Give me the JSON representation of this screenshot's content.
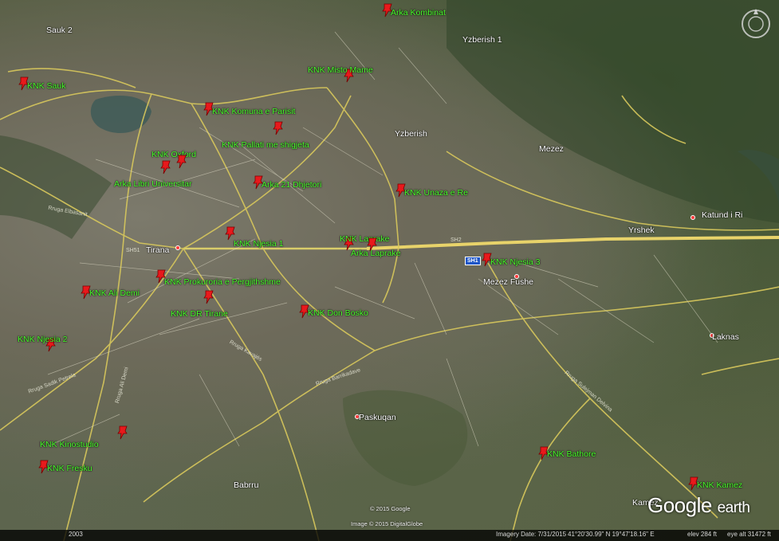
{
  "map": {
    "brand": {
      "google": "Google",
      "earth": "earth"
    },
    "copyright_google": "© 2015 Google",
    "copyright_image": "Image © 2015 DigitalGlobe",
    "status": {
      "imagery_date": "Imagery Date: 7/31/2015",
      "coords": "41°20'30.99\" N  19°47'18.16\" E",
      "elev": "elev  284 ft",
      "eye_alt": "eye alt  31472 ft",
      "year_badge": "2003"
    },
    "highway_shield": "SH1",
    "markers": [
      {
        "name": "marker-arka-kombinat",
        "label": "Arka Kombinat"
      },
      {
        "name": "marker-knk-sauk",
        "label": "KNK Sauk"
      },
      {
        "name": "marker-knk-misto-mame",
        "label": "KNK Misto Mame"
      },
      {
        "name": "marker-knk-komuna-e-parisit",
        "label": "KNK Komuna e Parisit"
      },
      {
        "name": "marker-knk-pallati-me-shigjeta",
        "label": "KNK Pallati me shigjeta"
      },
      {
        "name": "marker-knk-oxford",
        "label": "KNK Oxford"
      },
      {
        "name": "marker-arka-libri-universitar",
        "label": "Arka Libri Universitar"
      },
      {
        "name": "marker-arka-21-dhjetori",
        "label": "Arka 21 Dhjetori"
      },
      {
        "name": "marker-knk-unaza-e-re",
        "label": "KNK Unaza e Re"
      },
      {
        "name": "marker-knk-lapraka",
        "label": "KNK Laprake"
      },
      {
        "name": "marker-arka-lapraka",
        "label": "Arka Laprake"
      },
      {
        "name": "marker-knk-njesia-1",
        "label": "KNK Njesia 1"
      },
      {
        "name": "marker-knk-njesia-3",
        "label": "KNK Njesia 3"
      },
      {
        "name": "marker-knk-prokuroria",
        "label": "KNK Prokuroria e Pergjithshme"
      },
      {
        "name": "marker-knk-ali-demi",
        "label": "KNK Ali Demi"
      },
      {
        "name": "marker-knk-dr-tirane",
        "label": "KNK DR Tirane"
      },
      {
        "name": "marker-knk-don-bosko",
        "label": "KNK Don Bosko"
      },
      {
        "name": "marker-knk-njesia-2",
        "label": "KNK Njesia 2"
      },
      {
        "name": "marker-knk-kinostudio",
        "label": "KNK Kinostudio"
      },
      {
        "name": "marker-knk-fresku",
        "label": "KNK Fresku"
      },
      {
        "name": "marker-knk-bathore",
        "label": "KNK Bathore"
      },
      {
        "name": "marker-knk-kamez",
        "label": "KNK Kamez"
      }
    ],
    "places": [
      {
        "name": "place-sauk-2",
        "label": "Sauk 2"
      },
      {
        "name": "place-yzberish-1",
        "label": "Yzberish 1"
      },
      {
        "name": "place-yzberish",
        "label": "Yzberish"
      },
      {
        "name": "place-mezez",
        "label": "Mezez"
      },
      {
        "name": "place-katund-i-ri",
        "label": "Katund i Ri"
      },
      {
        "name": "place-yrshek",
        "label": "Yrshek"
      },
      {
        "name": "place-tirana",
        "label": "Tirana"
      },
      {
        "name": "place-mezez-fushe",
        "label": "Mezez Fushe"
      },
      {
        "name": "place-laknas",
        "label": "Laknas"
      },
      {
        "name": "place-paskuqan",
        "label": "Paskuqan"
      },
      {
        "name": "place-babrru",
        "label": "Babrru"
      },
      {
        "name": "place-kamez",
        "label": "Kamez"
      }
    ],
    "road_labels": [
      "Rruga Elbasanit",
      "Rruga Sadik Petrela",
      "Rruga e Dibrës",
      "Rruga Ali Demi",
      "Rruga Kavajës",
      "Rruga Durrës",
      "SH2",
      "Rruga Barrikadave",
      "Rruga Sulejman Delvina",
      "Rruga Dritan Hoxha",
      "Rruga Zogu i Zi",
      "Rruga Kastriot Jonuzi",
      "SH51"
    ]
  }
}
